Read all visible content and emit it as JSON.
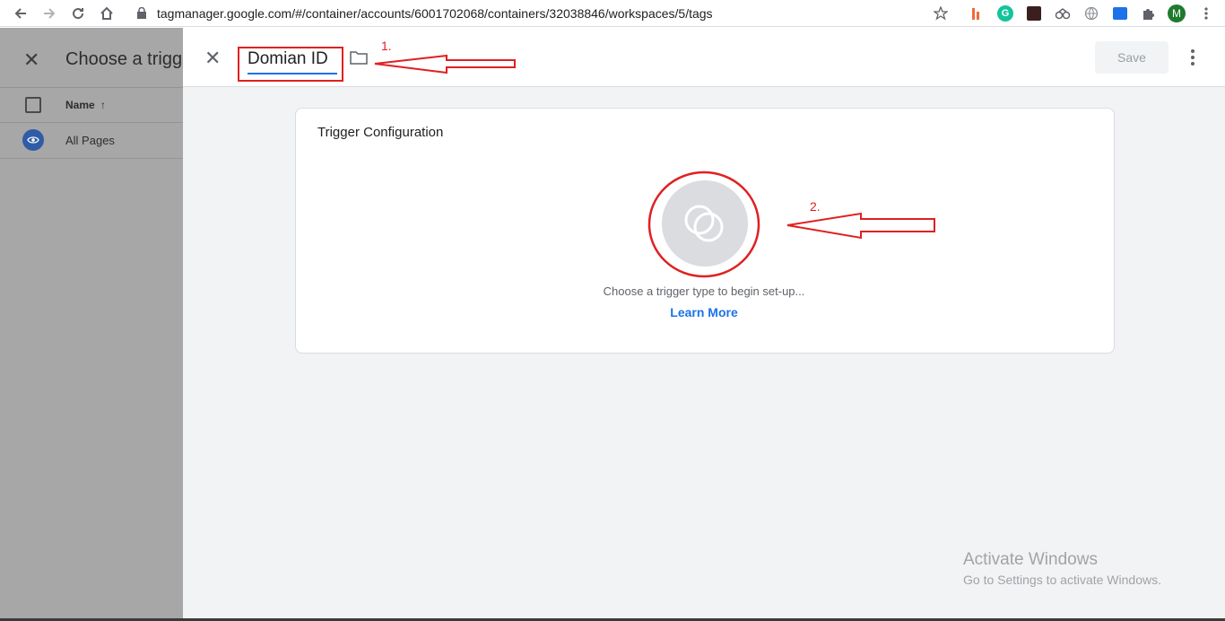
{
  "browser": {
    "url": "tagmanager.google.com/#/container/accounts/6001702068/containers/32038846/workspaces/5/tags",
    "profile_initial": "M",
    "extension_grammarly": "G"
  },
  "left_panel": {
    "title": "Choose a trigger",
    "column_header": "Name",
    "sort_arrow": "↑",
    "rows": [
      {
        "label": "All Pages"
      }
    ]
  },
  "editor": {
    "trigger_name": "Domian ID",
    "save_label": "Save"
  },
  "card": {
    "title": "Trigger Configuration",
    "help_text": "Choose a trigger type to begin set-up...",
    "learn_more": "Learn More"
  },
  "annotations": {
    "label_1": "1.",
    "label_2": "2."
  },
  "watermark": {
    "title": "Activate Windows",
    "subtitle": "Go to Settings to activate Windows."
  },
  "colors": {
    "annotation_red": "#e02020",
    "link_blue": "#1a73e8",
    "overlay_gray": "#a7a7a7"
  }
}
